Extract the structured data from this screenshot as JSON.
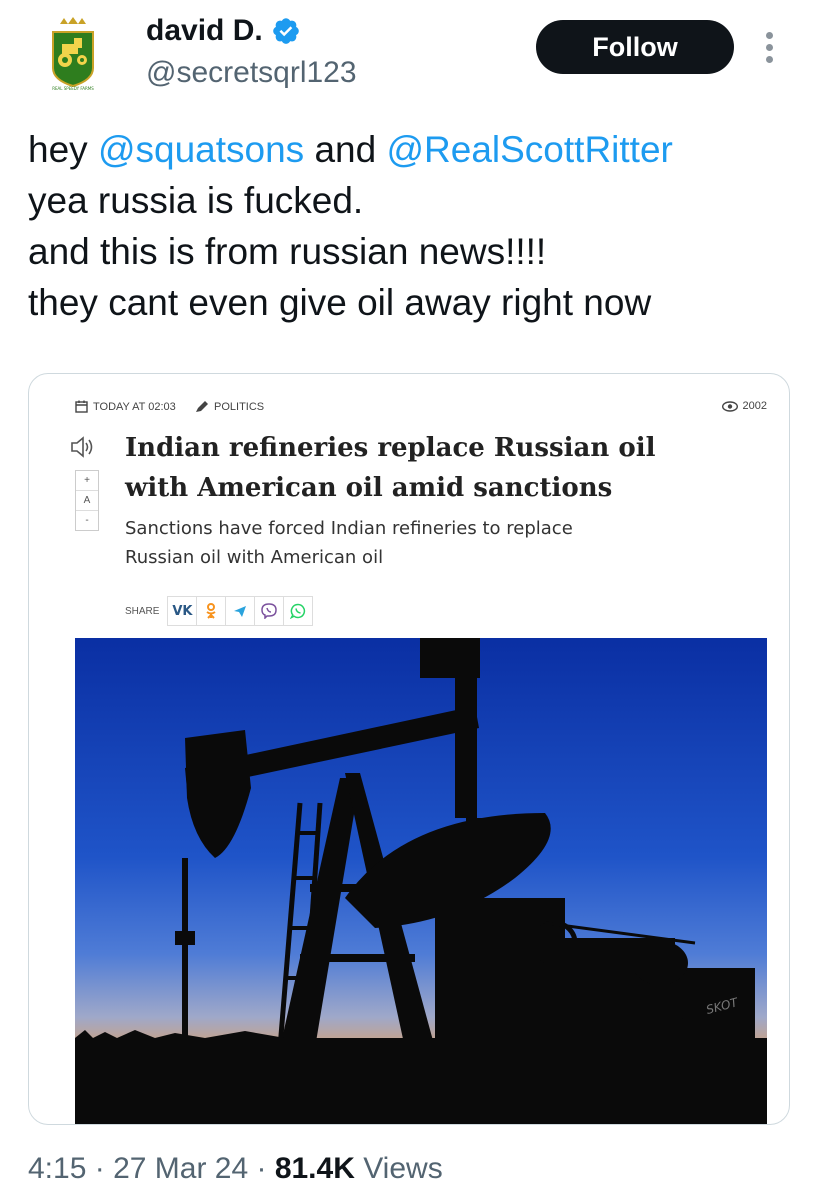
{
  "author": {
    "display_name": "david D.",
    "handle": "@secretsqrl123",
    "verified": true,
    "avatar_icon": "tractor-shield-logo-icon",
    "avatar_caption": "REAL SPEEDY FARMS"
  },
  "follow_button": {
    "label": "Follow"
  },
  "more_menu": {
    "icon": "more-vertical-icon"
  },
  "tweet": {
    "line1_prefix": "hey ",
    "mention1": "@squatsons",
    "line1_mid": " and ",
    "mention2": "@RealScottRitter",
    "line2": "yea russia is fucked.",
    "line3": "and this is from russian news!!!!",
    "line4": "they cant even give oil away right now"
  },
  "article": {
    "date": "TODAY AT 02:03",
    "category": "POLITICS",
    "views": "2002",
    "headline_line1": "Indian refineries replace Russian oil",
    "headline_line2": "with American oil amid sanctions",
    "subtitle_line1": "Sanctions have forced Indian refineries to replace",
    "subtitle_line2": "Russian oil with American oil",
    "share_label": "SHARE",
    "font_controls": [
      "+",
      "A",
      "-"
    ],
    "share_icons": [
      "vk-icon",
      "odnoklassniki-icon",
      "telegram-icon",
      "viber-icon",
      "whatsapp-icon"
    ],
    "image_description_icon": "oil-pumpjack-silhouette",
    "photo_watermark": "SKOT"
  },
  "footer": {
    "time": "4:15",
    "sep1": " · ",
    "date": "27 Mar 24",
    "sep2": " · ",
    "views_count": "81.4K",
    "views_label": " Views"
  },
  "colors": {
    "mention": "#1d9bf0",
    "follow_bg": "#0f1419",
    "secondary_text": "#536471",
    "verified": "#1d9bf0"
  }
}
